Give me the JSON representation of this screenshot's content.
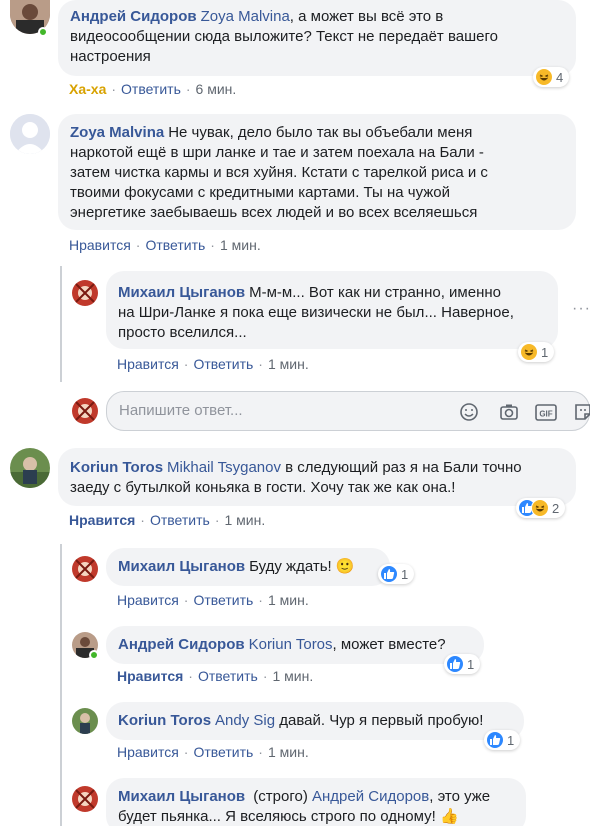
{
  "comments": [
    {
      "author": "Андрей Сидоров",
      "mention": "Zoya Malvina",
      "text_lines": [
        ", а может вы всё это в",
        "видеосообщении сюда выложите? Текст не передаёт вашего",
        "настроения"
      ],
      "reaction_label": "Ха-ха",
      "reply_label": "Ответить",
      "time": "6 мин.",
      "reaction_count": "4"
    },
    {
      "author": "Zoya Malvina",
      "text_lines": [
        "Не чувак, дело было так вы объебали меня",
        "наркотой ещё в шри ланке и тае и затем поехала на Бали -",
        "затем чистка кармы и вся хуйня. Кстати с тарелкой риса и с",
        "твоими фокусами с кредитными картами. Ты на чужой",
        "энергетике заебываешь всех людей и во всех вселяешься"
      ],
      "like_label": "Нравится",
      "reply_label": "Ответить",
      "time": "1 мин."
    },
    {
      "author": "Михаил Цыганов",
      "text_lines": [
        "М-м-м... Вот как ни странно, именно",
        "на Шри-Ланке я пока еще визически не был... Наверное,",
        "просто вселился..."
      ],
      "like_label": "Нравится",
      "reply_label": "Ответить",
      "time": "1 мин.",
      "reaction_count": "1"
    },
    {
      "author": "Koriun Toros",
      "mention": "Mikhail Tsyganov",
      "text_lines": [
        " в следующий раз я на Бали точно",
        "заеду с бутылкой коньяка в гости. Хочу так же как она.!"
      ],
      "like_label": "Нравится",
      "reply_label": "Ответить",
      "time": "1 мин.",
      "reaction_count": "2"
    },
    {
      "author": "Михаил Цыганов",
      "text": "Буду ждать! 🙂",
      "like_label": "Нравится",
      "reply_label": "Ответить",
      "time": "1 мин.",
      "reaction_count": "1"
    },
    {
      "author": "Андрей Сидоров",
      "mention": "Koriun Toros",
      "text": ", может вместе?",
      "like_label": "Нравится",
      "reply_label": "Ответить",
      "time": "1 мин.",
      "reaction_count": "1"
    },
    {
      "author": "Koriun Toros",
      "mention": "Andy Sig",
      "text": " давай. Чур я первый пробую!",
      "like_label": "Нравится",
      "reply_label": "Ответить",
      "time": "1 мин.",
      "reaction_count": "1"
    },
    {
      "author": "Михаил Цыганов",
      "prefix": " (строго) ",
      "mention": "Андрей Сидоров",
      "text_lines": [
        ", это уже",
        "будет пьянка... Я вселяюсь строго по одному! 👍"
      ]
    }
  ],
  "reply_box": {
    "placeholder": "Напишите ответ..."
  },
  "icons": [
    "emoji-icon",
    "camera-icon",
    "gif-icon",
    "sticker-icon",
    "like-reaction-icon",
    "haha-reaction-icon",
    "more-options-icon"
  ],
  "colors": {
    "link": "#385898",
    "bubble": "#f2f3f5",
    "meta": "#606770",
    "haha": "#d8a200",
    "like": "#2d88ff",
    "online": "#42b72a"
  }
}
